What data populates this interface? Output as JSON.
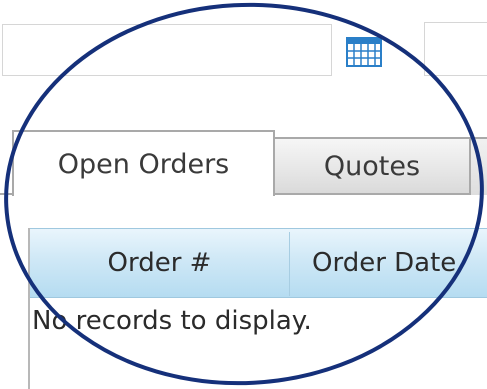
{
  "filters": {
    "date_value": "",
    "second_value": ""
  },
  "icons": {
    "calendar": "calendar-icon"
  },
  "tabs": [
    {
      "label": "Open Orders",
      "active": true
    },
    {
      "label": "Quotes",
      "active": false
    }
  ],
  "grid": {
    "columns": [
      "Order #",
      "Order Date"
    ],
    "empty_message": "No records to display."
  },
  "colors": {
    "header_blue": "#cfe8f6",
    "callout_stroke": "#15307a",
    "calendar_blue": "#2a7fc8"
  }
}
